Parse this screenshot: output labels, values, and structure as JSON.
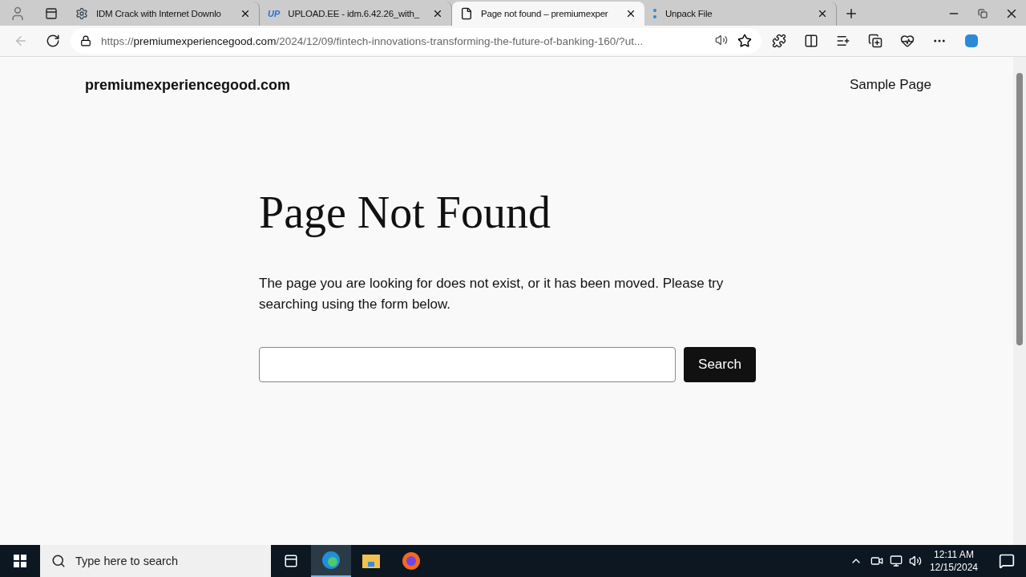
{
  "browser": {
    "tabs": [
      {
        "title": "IDM Crack with Internet Downlo",
        "kind": "gear",
        "selected": false
      },
      {
        "title": "UPLOAD.EE - idm.6.42.26_with_",
        "kind": "up",
        "badge": "UP",
        "selected": false
      },
      {
        "title": "Page not found – premiumexper",
        "kind": "page",
        "selected": true
      },
      {
        "title": "Unpack File",
        "kind": "dots",
        "selected": false
      }
    ],
    "address": {
      "scheme": "https://",
      "host": "premiumexperiencegood.com",
      "path": "/2024/12/09/fintech-innovations-transforming-the-future-of-banking-160/?ut..."
    }
  },
  "site": {
    "title": "premiumexperiencegood.com",
    "nav": [
      "Sample Page"
    ]
  },
  "content": {
    "heading": "Page Not Found",
    "message": "The page you are looking for does not exist, or it has been moved. Please try searching using the form below.",
    "search_button": "Search"
  },
  "taskbar": {
    "search_placeholder": "Type here to search",
    "time": "12:11 AM",
    "date": "12/15/2024"
  }
}
